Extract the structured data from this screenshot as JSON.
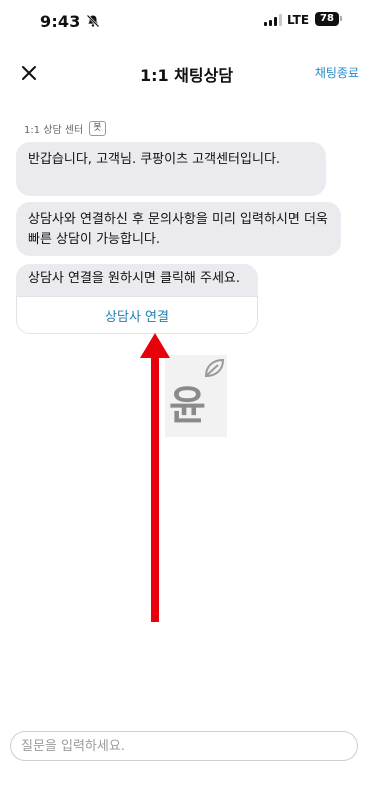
{
  "status_bar": {
    "time": "9:43",
    "network": "LTE",
    "battery": "78"
  },
  "header": {
    "title": "1:1 채팅상담",
    "end_chat_label": "채팅종료"
  },
  "chat": {
    "sender_name": "1:1 상담 센터",
    "sender_badge": "봇",
    "messages": [
      "반갑습니다, 고객님. 쿠팡이츠 고객센터입니다.",
      "상담사와 연결하신 후 문의사항을 미리 입력하시면 더욱 빠른 상담이 가능합니다."
    ],
    "connect_card": {
      "text": "상담사 연결을 원하시면 클릭해 주세요.",
      "button_label": "상담사 연결"
    }
  },
  "watermark": {
    "text": "윤"
  },
  "composer": {
    "placeholder": "질문을 입력하세요."
  },
  "colors": {
    "accent": "#2a8ec8",
    "bubble": "#ebebef",
    "arrow": "#e8000a"
  },
  "icons": [
    "bell-slash-icon",
    "close-icon",
    "leaf-icon",
    "arrow-up-icon"
  ]
}
